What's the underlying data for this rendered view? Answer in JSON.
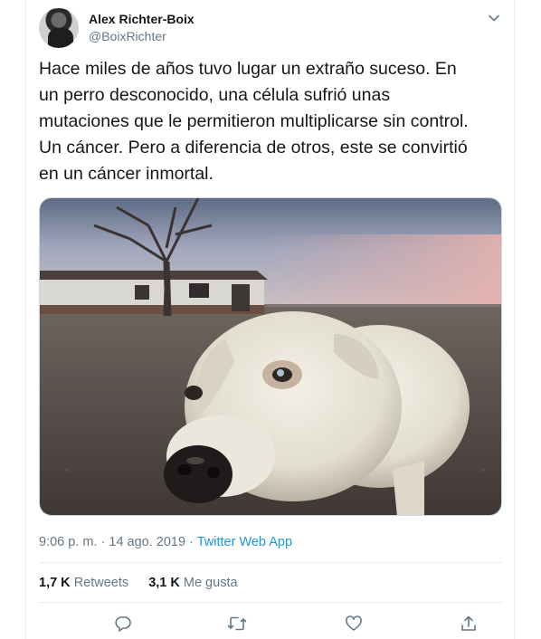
{
  "user": {
    "name": "Alex Richter-Boix",
    "handle": "@BoixRichter"
  },
  "tweet": {
    "text": "Hace miles de años tuvo lugar un extraño suceso. En\nun perro desconocido, una célula sufrió unas\nmutaciones que le permitieron multiplicarse sin control.\nUn cáncer. Pero a diferencia de otros, este se convirtió\nen un cáncer inmortal.",
    "photo_alt": "",
    "time": "9:06 p. m.",
    "date": "14 ago. 2019",
    "separator": "·",
    "source": "Twitter Web App"
  },
  "stats": {
    "retweets_count": "1,7 K",
    "retweets_label": "Retweets",
    "likes_count": "3,1 K",
    "likes_label": "Me gusta"
  },
  "icons": {
    "caret": "chevron-down-icon",
    "reply": "reply-icon",
    "retweet": "retweet-icon",
    "like": "heart-icon",
    "share": "share-icon"
  },
  "colors": {
    "text": "#14171a",
    "secondary": "#657786",
    "link": "#1b95e0",
    "border": "#e6ecf0"
  }
}
